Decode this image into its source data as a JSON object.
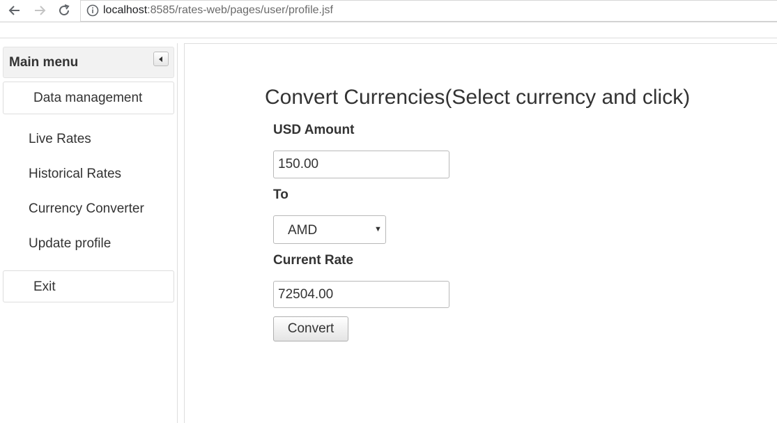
{
  "browser": {
    "back_icon": "arrow-left-icon",
    "forward_icon": "arrow-right-icon",
    "reload_icon": "reload-icon",
    "info_icon": "info-icon",
    "url_host": "localhost",
    "url_rest": ":8585/rates-web/pages/user/profile.jsf"
  },
  "sidebar": {
    "title": "Main menu",
    "collapse_icon": "triangle-left-icon",
    "data_management_label": "Data management",
    "items": [
      {
        "label": "Live Rates"
      },
      {
        "label": "Historical Rates"
      },
      {
        "label": "Currency Converter"
      },
      {
        "label": "Update profile"
      }
    ],
    "exit_label": "Exit"
  },
  "converter": {
    "title": "Convert Currencies(Select currency and click)",
    "usd_amount_label": "USD Amount",
    "usd_amount_value": "150.00",
    "to_label": "To",
    "to_selected": "AMD",
    "current_rate_label": "Current Rate",
    "current_rate_value": "72504.00",
    "convert_label": "Convert"
  },
  "colors": {
    "text": "#333333",
    "border": "#dddddd",
    "header_bg": "#f2f2f2"
  }
}
